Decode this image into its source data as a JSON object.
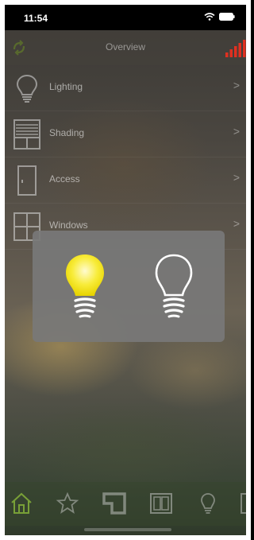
{
  "status_bar": {
    "time": "11:54"
  },
  "header": {
    "title": "Overview"
  },
  "menu": {
    "items": [
      {
        "label": "Lighting",
        "icon": "lightbulb-icon"
      },
      {
        "label": "Shading",
        "icon": "shading-icon"
      },
      {
        "label": "Access",
        "icon": "door-icon"
      },
      {
        "label": "Windows",
        "icon": "window-icon"
      }
    ],
    "chevron": ">"
  },
  "popup": {
    "options": [
      {
        "state": "on",
        "icon": "lightbulb-on-icon",
        "color": "#F5E000"
      },
      {
        "state": "off",
        "icon": "lightbulb-off-icon",
        "color": "#FFFFFF"
      }
    ]
  },
  "tabbar": {
    "tabs": [
      {
        "icon": "home-icon",
        "active": true
      },
      {
        "icon": "star-icon",
        "active": false
      },
      {
        "icon": "floorplan-icon",
        "active": false
      },
      {
        "icon": "window-icon",
        "active": false
      },
      {
        "icon": "lightbulb-icon",
        "active": false
      },
      {
        "icon": "more-icon",
        "active": false
      }
    ]
  },
  "colors": {
    "accent_green": "#6B8E23",
    "signal_red": "#E03020",
    "bulb_on": "#F5E000"
  }
}
